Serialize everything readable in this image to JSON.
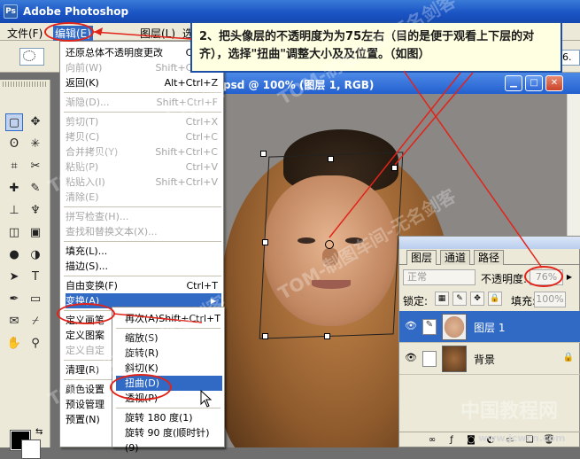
{
  "app": {
    "title": "Adobe Photoshop",
    "logo": "Ps"
  },
  "menubar": {
    "items": [
      "文件(F)",
      "编辑(E)",
      "图层(L)",
      "选"
    ]
  },
  "options": {
    "right_label": "R:",
    "right_value": "6."
  },
  "toolbox": {
    "tools": [
      "marquee-icon",
      "move-icon",
      "lasso-icon",
      "magic-wand-icon",
      "crop-icon",
      "slice-icon",
      "healing-icon",
      "brush-icon",
      "stamp-icon",
      "history-brush-icon",
      "eraser-icon",
      "gradient-icon",
      "blur-icon",
      "dodge-icon",
      "path-select-icon",
      "type-icon",
      "pen-icon",
      "shape-icon",
      "notes-icon",
      "eyedropper-icon",
      "hand-icon",
      "zoom-icon"
    ],
    "tool_glyphs": [
      "▢",
      "✥",
      "ʘ",
      "✳",
      "⌗",
      "✂",
      "✚",
      "✎",
      "⊥",
      "♆",
      "◫",
      "▣",
      "●",
      "◑",
      "➤",
      "T",
      "✒",
      "▭",
      "✉",
      "⌿",
      "✋",
      "⚲"
    ]
  },
  "document": {
    "title": "psd @ 100% (图层 1, RGB)"
  },
  "edit_menu": {
    "header": "编辑(E)",
    "items": [
      {
        "label": "还原总体不透明度更改",
        "shortcut": "Ctrl+Z",
        "disabled": false
      },
      {
        "label": "向前(W)",
        "shortcut": "Shift+Ctrl+Z",
        "disabled": true
      },
      {
        "label": "返回(K)",
        "shortcut": "Alt+Ctrl+Z",
        "disabled": false
      },
      {
        "label": "渐隐(D)...",
        "shortcut": "Shift+Ctrl+F",
        "disabled": true
      },
      {
        "label": "剪切(T)",
        "shortcut": "Ctrl+X",
        "disabled": true
      },
      {
        "label": "拷贝(C)",
        "shortcut": "Ctrl+C",
        "disabled": true
      },
      {
        "label": "合并拷贝(Y)",
        "shortcut": "Shift+Ctrl+C",
        "disabled": true
      },
      {
        "label": "粘贴(P)",
        "shortcut": "Ctrl+V",
        "disabled": true
      },
      {
        "label": "粘贴入(I)",
        "shortcut": "Shift+Ctrl+V",
        "disabled": true
      },
      {
        "label": "清除(E)",
        "shortcut": "",
        "disabled": true
      },
      {
        "label": "拼写检查(H)...",
        "shortcut": "",
        "disabled": true
      },
      {
        "label": "查找和替换文本(X)...",
        "shortcut": "",
        "disabled": true
      },
      {
        "label": "填充(L)...",
        "shortcut": "",
        "disabled": false
      },
      {
        "label": "描边(S)...",
        "shortcut": "",
        "disabled": false
      },
      {
        "label": "自由变换(F)",
        "shortcut": "Ctrl+T",
        "disabled": false
      },
      {
        "label": "变换(A)",
        "shortcut": "",
        "disabled": false,
        "submenu": true
      },
      {
        "label": "定义画笔",
        "shortcut": "",
        "disabled": false
      },
      {
        "label": "定义图案",
        "shortcut": "",
        "disabled": false
      },
      {
        "label": "定义自定",
        "shortcut": "",
        "disabled": true
      },
      {
        "label": "清理(R)",
        "shortcut": "",
        "disabled": false,
        "submenu": true
      },
      {
        "label": "颜色设置",
        "shortcut": "",
        "disabled": false
      },
      {
        "label": "预设管理",
        "shortcut": "",
        "disabled": false
      },
      {
        "label": "预置(N)",
        "shortcut": "",
        "disabled": false
      }
    ]
  },
  "transform_submenu": {
    "items": [
      {
        "label": "再次(A)",
        "shortcut": "Shift+Ctrl+T"
      },
      {
        "label": "缩放(S)",
        "shortcut": ""
      },
      {
        "label": "旋转(R)",
        "shortcut": ""
      },
      {
        "label": "斜切(K)",
        "shortcut": ""
      },
      {
        "label": "扭曲(D)",
        "shortcut": "",
        "highlighted": true
      },
      {
        "label": "透视(P)",
        "shortcut": ""
      },
      {
        "label": "旋转 180 度(1)",
        "shortcut": ""
      },
      {
        "label": "旋转 90 度(顺时针)(9)",
        "shortcut": ""
      }
    ]
  },
  "layers": {
    "tabs": [
      "图层",
      "通道",
      "路径"
    ],
    "blend_mode": "正常",
    "opacity_label": "不透明度:",
    "opacity_value": "76%",
    "lock_label": "锁定:",
    "fill_label": "填充:",
    "fill_value": "100%",
    "rows": [
      {
        "name": "图层 1",
        "selected": true
      },
      {
        "name": "背景",
        "selected": false
      }
    ]
  },
  "annotation": {
    "text": "2、把头像层的不透明度为为75左右（目的是便于观看上下层的对齐），选择\"扭曲\"调整大小及及位置。（如图）"
  },
  "watermarks": {
    "text": "TOM-制图车间-无名剑客",
    "site": "www.jcwcn.com",
    "logo": "中国教程网"
  },
  "colors": {
    "accent": "#316ac5",
    "highlight_ring": "#e2231a",
    "titlebar": "#1b55c5"
  }
}
